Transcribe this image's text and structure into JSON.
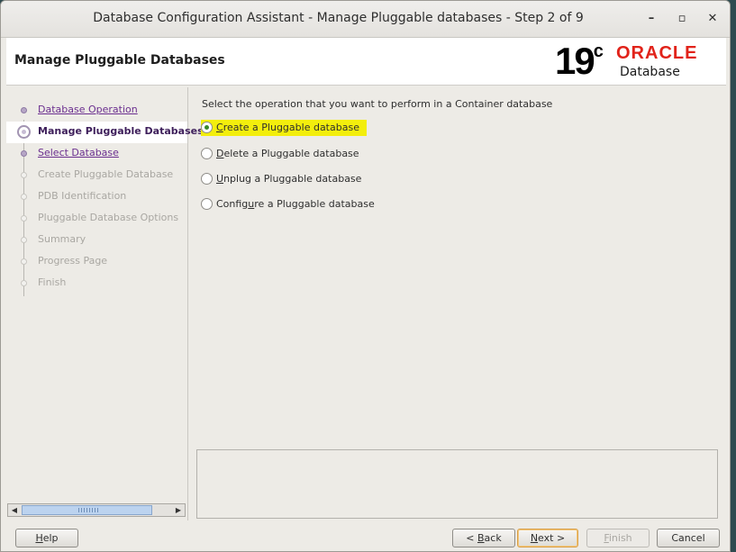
{
  "window": {
    "title": "Database Configuration Assistant - Manage Pluggable databases - Step 2 of 9"
  },
  "header": {
    "page_title": "Manage Pluggable Databases",
    "version": "19",
    "version_suffix": "c",
    "brand": "ORACLE",
    "product": "Database"
  },
  "steps": [
    {
      "label": "Database Operation",
      "state": "done"
    },
    {
      "label": "Manage Pluggable Databases",
      "state": "current"
    },
    {
      "label": "Select Database",
      "state": "done"
    },
    {
      "label": "Create Pluggable Database",
      "state": "pending"
    },
    {
      "label": "PDB Identification",
      "state": "pending"
    },
    {
      "label": "Pluggable Database Options",
      "state": "pending"
    },
    {
      "label": "Summary",
      "state": "pending"
    },
    {
      "label": "Progress Page",
      "state": "pending"
    },
    {
      "label": "Finish",
      "state": "pending"
    }
  ],
  "main": {
    "prompt": "Select the operation that you want to perform in a Container database",
    "options": [
      {
        "mnemonic": "C",
        "rest": "reate a Pluggable database",
        "selected": true
      },
      {
        "mnemonic": "D",
        "rest": "elete a Pluggable database",
        "selected": false
      },
      {
        "mnemonic": "U",
        "rest": "nplug a Pluggable database",
        "selected": false
      },
      {
        "pre": "Config",
        "mnemonic": "u",
        "rest": "re a Pluggable database",
        "selected": false
      }
    ]
  },
  "footer": {
    "help": {
      "mnemonic": "H",
      "rest": "elp"
    },
    "back": {
      "pre": "< ",
      "mnemonic": "B",
      "rest": "ack"
    },
    "next": {
      "mnemonic": "N",
      "rest": "ext >"
    },
    "finish": {
      "mnemonic": "F",
      "rest": "inish"
    },
    "cancel": "Cancel"
  },
  "colors": {
    "highlight": "#f3ee0c",
    "accent": "#6b2f8f",
    "brand_red": "#e1231a"
  },
  "icons": {
    "minimize": "minimize-icon",
    "maximize": "maximize-icon",
    "close": "close-icon"
  }
}
